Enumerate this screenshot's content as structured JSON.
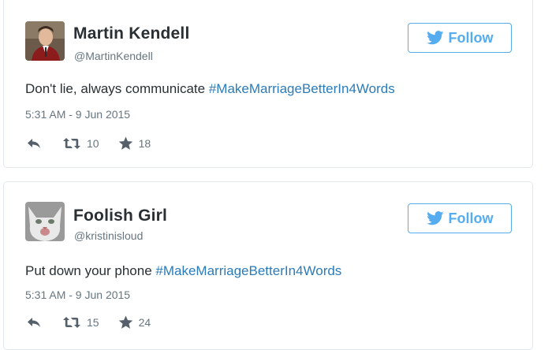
{
  "tweets": [
    {
      "name": "Martin Kendell",
      "handle": "@MartinKendell",
      "follow_label": "Follow",
      "text": "Don't lie, always communicate ",
      "hashtag": "#MakeMarriageBetterIn4Words",
      "timestamp": "5:31 AM - 9 Jun 2015",
      "retweets": "10",
      "favorites": "18"
    },
    {
      "name": "Foolish Girl",
      "handle": "@kristinisloud",
      "follow_label": "Follow",
      "text": "Put down your phone ",
      "hashtag": "#MakeMarriageBetterIn4Words",
      "timestamp": "5:31 AM - 9 Jun 2015",
      "retweets": "15",
      "favorites": "24"
    }
  ],
  "colors": {
    "brand": "#55acee",
    "hashtag": "#2b7bb9",
    "muted": "#66757f",
    "text": "#292f33"
  },
  "icons": [
    "twitter-bird-icon",
    "reply-icon",
    "retweet-icon",
    "favorite-star-icon"
  ]
}
